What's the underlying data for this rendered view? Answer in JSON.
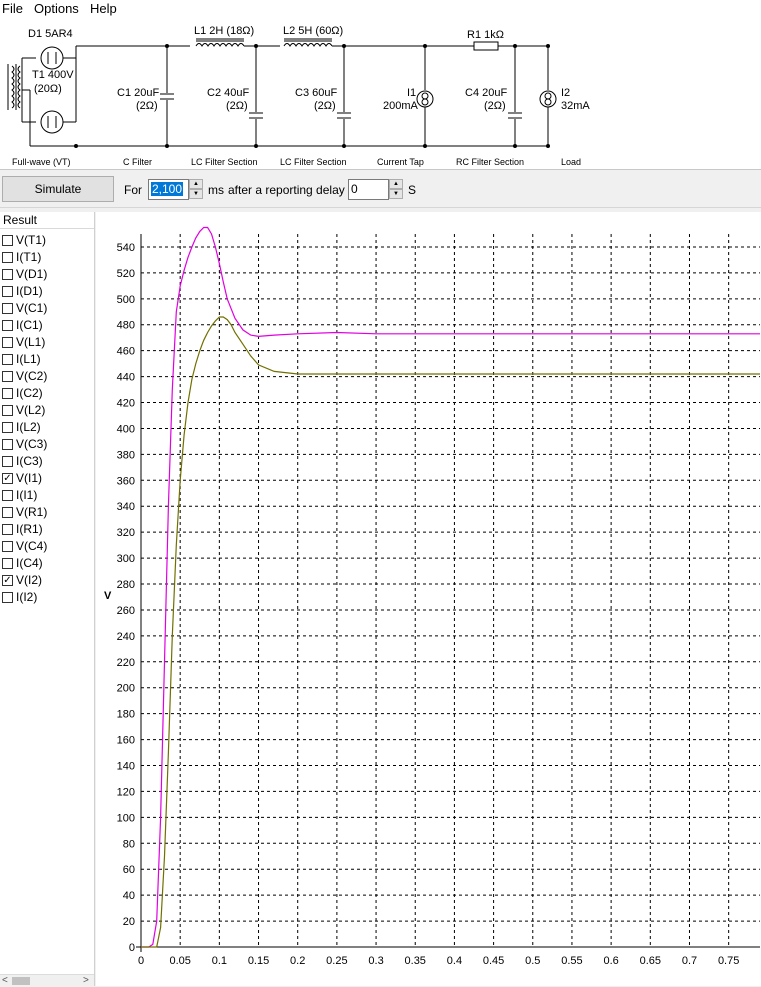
{
  "menu": [
    "File",
    "Options",
    "Help"
  ],
  "circuit": {
    "d1": "D1 5AR4",
    "t1_line1": "T1 400V",
    "t1_line2": "(20Ω)",
    "l1": "L1 2H (18Ω)",
    "l2": "L2 5H (60Ω)",
    "r1": "R1 1kΩ",
    "c1_line1": "C1 20uF",
    "c1_line2": "(2Ω)",
    "c2_line1": "C2 40uF",
    "c2_line2": "(2Ω)",
    "c3_line1": "C3 60uF",
    "c3_line2": "(2Ω)",
    "i1_line1": "I1",
    "i1_line2": "200mA",
    "c4_line1": "C4 20uF",
    "c4_line2": "(2Ω)",
    "i2_line1": "I2",
    "i2_line2": "32mA",
    "sections": [
      "Full-wave (VT)",
      "C Filter",
      "LC Filter Section",
      "LC Filter Section",
      "Current Tap",
      "RC Filter Section",
      "Load"
    ]
  },
  "toolbar": {
    "simulate_label": "Simulate",
    "for_label": "For",
    "duration_value": "2,100",
    "ms_label": "ms",
    "delay_label": "after a reporting delay of",
    "delay_value": "0",
    "s_label": "S"
  },
  "results": {
    "header": "Result",
    "items": [
      {
        "label": "V(T1)",
        "checked": false
      },
      {
        "label": "I(T1)",
        "checked": false
      },
      {
        "label": "V(D1)",
        "checked": false
      },
      {
        "label": "I(D1)",
        "checked": false
      },
      {
        "label": "V(C1)",
        "checked": false
      },
      {
        "label": "I(C1)",
        "checked": false
      },
      {
        "label": "V(L1)",
        "checked": false
      },
      {
        "label": "I(L1)",
        "checked": false
      },
      {
        "label": "V(C2)",
        "checked": false
      },
      {
        "label": "I(C2)",
        "checked": false
      },
      {
        "label": "V(L2)",
        "checked": false
      },
      {
        "label": "I(L2)",
        "checked": false
      },
      {
        "label": "V(C3)",
        "checked": false
      },
      {
        "label": "I(C3)",
        "checked": false
      },
      {
        "label": "V(I1)",
        "checked": true
      },
      {
        "label": "I(I1)",
        "checked": false
      },
      {
        "label": "V(R1)",
        "checked": false
      },
      {
        "label": "I(R1)",
        "checked": false
      },
      {
        "label": "V(C4)",
        "checked": false
      },
      {
        "label": "I(C4)",
        "checked": false
      },
      {
        "label": "V(I2)",
        "checked": true
      },
      {
        "label": "I(I2)",
        "checked": false
      }
    ]
  },
  "chart_data": {
    "type": "line",
    "ylabel": "V",
    "xlabel": "",
    "xlim": [
      0,
      0.79
    ],
    "ylim": [
      0,
      550
    ],
    "yticks": [
      0,
      20,
      40,
      60,
      80,
      100,
      120,
      140,
      160,
      180,
      200,
      220,
      240,
      260,
      280,
      300,
      320,
      340,
      360,
      380,
      400,
      420,
      440,
      460,
      480,
      500,
      520,
      540
    ],
    "xticks": [
      "0",
      "0.05",
      "0.1",
      "0.15",
      "0.2",
      "0.25",
      "0.3",
      "0.35",
      "0.4",
      "0.45",
      "0.5",
      "0.55",
      "0.6",
      "0.65",
      "0.7",
      "0.75"
    ],
    "grid": true,
    "series": [
      {
        "color": "#e000e0",
        "x": [
          0,
          0.01,
          0.015,
          0.02,
          0.025,
          0.03,
          0.035,
          0.04,
          0.045,
          0.05,
          0.055,
          0.06,
          0.065,
          0.07,
          0.075,
          0.08,
          0.085,
          0.09,
          0.095,
          0.1,
          0.105,
          0.11,
          0.12,
          0.13,
          0.14,
          0.15,
          0.17,
          0.2,
          0.25,
          0.3,
          0.35,
          0.4,
          0.5,
          0.6,
          0.7,
          0.79
        ],
        "values": [
          0,
          0,
          2,
          20,
          100,
          220,
          340,
          430,
          490,
          510,
          522,
          532,
          540,
          547,
          552,
          555,
          555,
          550,
          540,
          527,
          513,
          500,
          485,
          476,
          472,
          471,
          472,
          473,
          474,
          473,
          473,
          473,
          473,
          473,
          473,
          473
        ]
      },
      {
        "color": "#707000",
        "x": [
          0,
          0.02,
          0.025,
          0.03,
          0.035,
          0.04,
          0.045,
          0.05,
          0.055,
          0.06,
          0.065,
          0.07,
          0.075,
          0.08,
          0.085,
          0.09,
          0.095,
          0.1,
          0.105,
          0.11,
          0.115,
          0.12,
          0.13,
          0.14,
          0.15,
          0.17,
          0.2,
          0.25,
          0.3,
          0.4,
          0.5,
          0.6,
          0.7,
          0.79
        ],
        "values": [
          0,
          0,
          15,
          70,
          150,
          240,
          310,
          360,
          395,
          420,
          438,
          450,
          460,
          468,
          474,
          479,
          483,
          486,
          486,
          484,
          480,
          474,
          465,
          456,
          449,
          444,
          442,
          442,
          442,
          442,
          442,
          442,
          442,
          442
        ]
      }
    ]
  }
}
